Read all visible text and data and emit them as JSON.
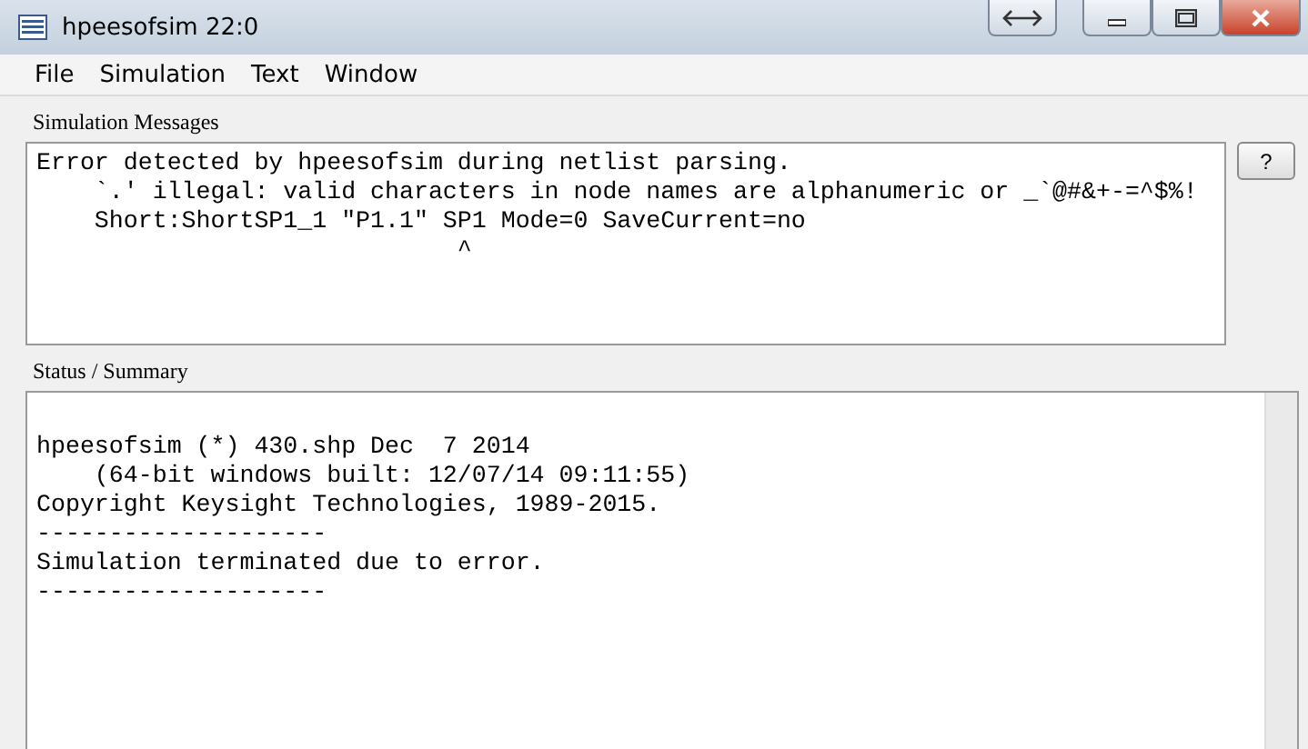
{
  "window": {
    "title": "hpeesofsim 22:0"
  },
  "menu": [
    "File",
    "Simulation",
    "Text",
    "Window"
  ],
  "simulation_messages": {
    "label": "Simulation Messages",
    "lines": [
      "Error detected by hpeesofsim during netlist parsing.",
      "    `.' illegal: valid characters in node names are alphanumeric or _`@#&+-=^$%!",
      "    Short:ShortSP1_1 \"P1.1\" SP1 Mode=0 SaveCurrent=no",
      "                             ^"
    ],
    "help_button": "?"
  },
  "status_summary": {
    "label": "Status / Summary",
    "lines": [
      "hpeesofsim (*) 430.shp Dec  7 2014",
      "    (64-bit windows built: 12/07/14 09:11:55)",
      "Copyright Keysight Technologies, 1989-2015.",
      "--------------------",
      "Simulation terminated due to error.",
      "--------------------"
    ]
  }
}
